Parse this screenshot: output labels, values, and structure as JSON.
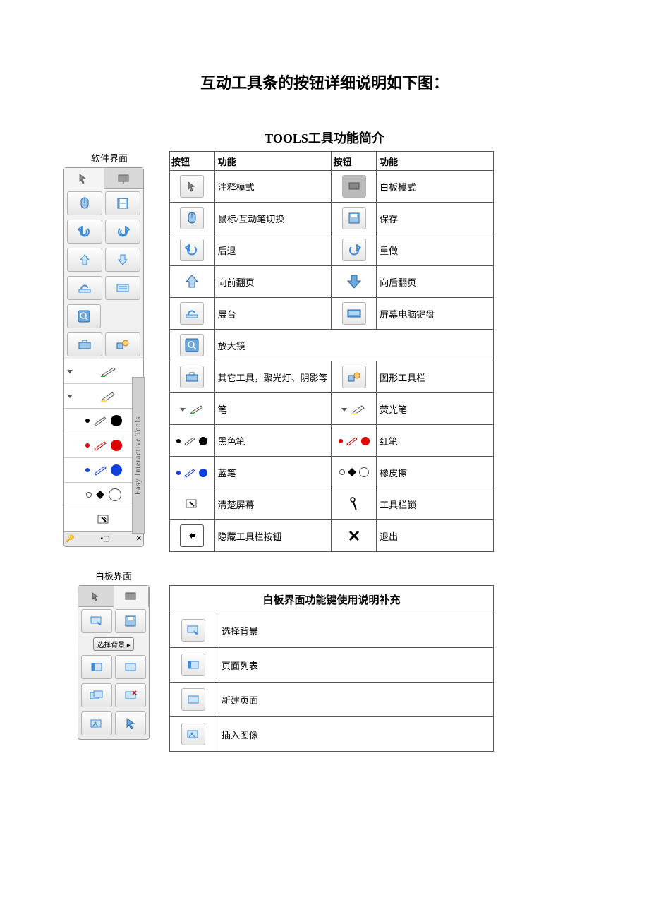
{
  "title": "互动工具条的按钮详细说明如下图：",
  "tools_title": "TOOLS工具功能简介",
  "panel1_label": "软件界面",
  "panel2_label": "白板界面",
  "side_vertical_label": "Easy Interactive Tools",
  "dropdown_text": "选择背景",
  "headers": {
    "button": "按钮",
    "func": "功能"
  },
  "rows": [
    {
      "l": "注释模式",
      "r": "白板模式"
    },
    {
      "l": "鼠标/互动笔切换",
      "r": "保存"
    },
    {
      "l": "后退",
      "r": "重做"
    },
    {
      "l": "向前翻页",
      "r": "向后翻页"
    },
    {
      "l": "展台",
      "r": "屏幕电脑键盘"
    },
    {
      "l": "放大镜",
      "r": ""
    },
    {
      "l": "其它工具，聚光灯、阴影等",
      "r": "图形工具栏"
    },
    {
      "l": "笔",
      "r": "荧光笔"
    },
    {
      "l": "黑色笔",
      "r": "红笔"
    },
    {
      "l": "蓝笔",
      "r": "橡皮擦"
    },
    {
      "l": "清楚屏幕",
      "r": "工具栏锁"
    },
    {
      "l": "隐藏工具栏按钮",
      "r": "退出"
    }
  ],
  "wb_title": "白板界面功能键使用说明补充",
  "wb_rows": [
    "选择背景",
    "页面列表",
    "新建页面",
    "插入图像"
  ]
}
